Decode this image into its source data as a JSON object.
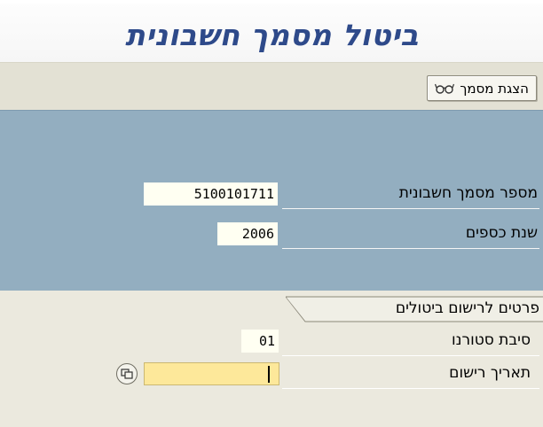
{
  "window": {
    "title": "ביטול מסמך חשבונית"
  },
  "toolbar": {
    "display_doc_button": "הצגת מסמך",
    "display_doc_icon": "glasses-icon"
  },
  "fields": {
    "doc_number": {
      "label": "מספר מסמך חשבונית",
      "value": "5100101711"
    },
    "fiscal_year": {
      "label": "שנת כספים",
      "value": "2006"
    }
  },
  "reversal_section": {
    "title": "פרטים לרישום ביטולים",
    "reason": {
      "label": "סיבת סטורנו",
      "value": "01"
    },
    "posting_date": {
      "label": "תאריך רישום",
      "value": "",
      "help_icon": "f4-help-icon"
    }
  },
  "colors": {
    "title": "#2e4a8a",
    "header_block": "#93aec0",
    "background": "#ebe9de",
    "active_field": "#fde89a"
  }
}
